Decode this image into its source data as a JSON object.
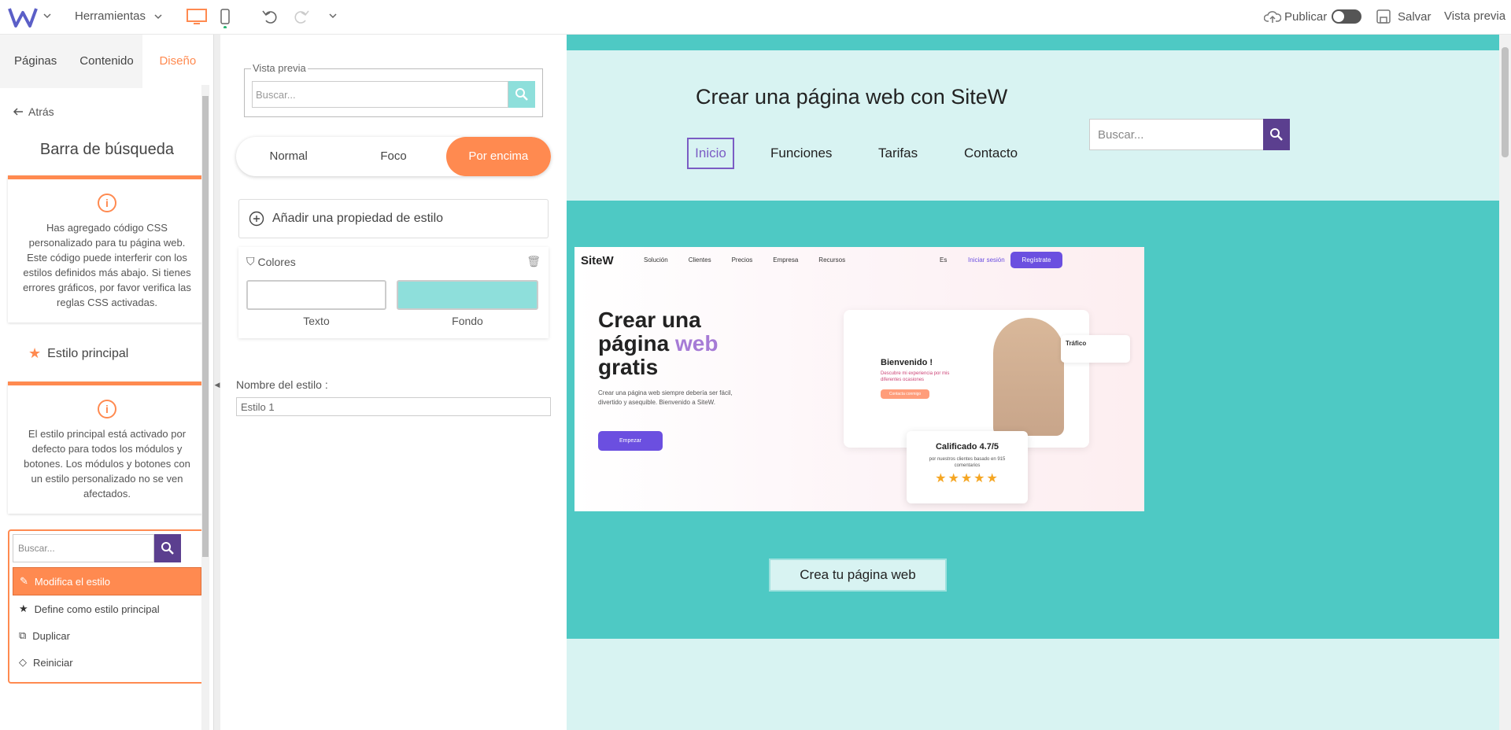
{
  "topbar": {
    "logo": "W",
    "tools_label": "Herramientas",
    "publish_label": "Publicar",
    "save_label": "Salvar",
    "preview_label": "Vista previa"
  },
  "left": {
    "tabs": [
      "Páginas",
      "Contenido",
      "Diseño"
    ],
    "back_label": "Atrás",
    "section_title": "Barra de búsqueda",
    "css_notice": "Has agregado código CSS personalizado para tu página web. Este código puede interferir con los estilos definidos más abajo. Si tienes errores gráficos, por favor verifica las reglas CSS activadas.",
    "main_style_label": "Estilo principal",
    "main_style_notice": "El estilo principal está activado por defecto para todos los módulos y botones. Los módulos y botones con un estilo personalizado no se ven afectados.",
    "search_placeholder": "Buscar...",
    "menu": [
      "Modifica el estilo",
      "Define como estilo principal",
      "Duplicar",
      "Reiniciar"
    ]
  },
  "mid": {
    "preview_legend": "Vista previa",
    "search_placeholder": "Buscar...",
    "states": [
      "Normal",
      "Foco",
      "Por encima"
    ],
    "add_property": "Añadir una propiedad de estilo",
    "colors_title": "Colores",
    "color_text_label": "Texto",
    "color_bg_label": "Fondo",
    "colors": {
      "text": "#ffffff",
      "bg": "#8edfdb"
    },
    "style_name_label": "Nombre del estilo :",
    "style_name_value": "Estilo 1"
  },
  "site": {
    "title": "Crear una página web con SiteW",
    "nav": [
      "Inicio",
      "Funciones",
      "Tarifas",
      "Contacto"
    ],
    "search_placeholder": "Buscar...",
    "cta": "Crea tu página web",
    "shot": {
      "logo": "SiteW",
      "nav": [
        "Solución",
        "Clientes",
        "Precios",
        "Empresa",
        "Recursos"
      ],
      "lang": "Es",
      "login": "Iniciar sesión",
      "register": "Regístrate",
      "h1_a": "Crear una",
      "h1_b": "página",
      "h1_web": "web",
      "h1_c": "gratis",
      "para": "Crear una página web siempre debería ser fácil, divertido y asequible. Bienvenido a SiteW.",
      "btn": "Empezar",
      "welcome": "Bienvenido !",
      "welcome_sub": "Descubre mi experiencia por mis diferentes ocasiones",
      "contact": "Contacta conmigo",
      "traffic": "Tráfico",
      "rating": "Calificado 4.7/5",
      "rating_sub": "por nuestros clientes basado en 915 comentarios"
    }
  },
  "colors": {
    "accent": "#ff8a50",
    "purple": "#5b3f8f",
    "teal": "#4ec9c4"
  }
}
